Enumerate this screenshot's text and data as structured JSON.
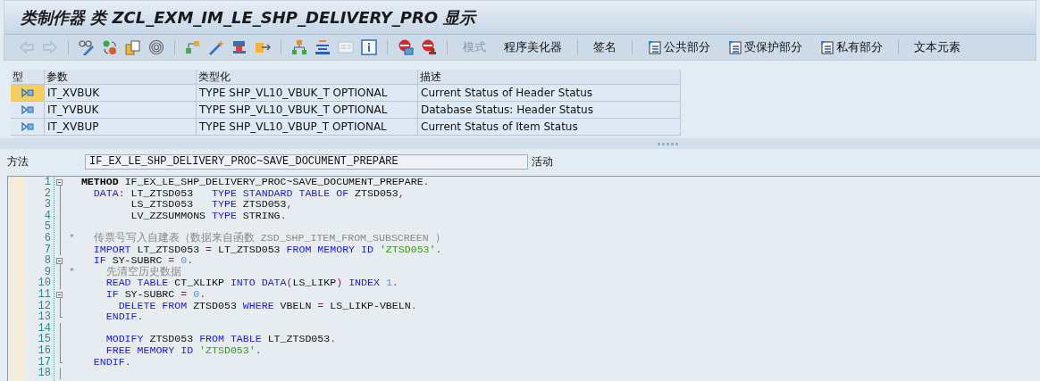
{
  "window": {
    "title": "类制作器 类 ZCL_EXM_IM_LE_SHP_DELIVERY_PRO 显示"
  },
  "toolbar": {
    "button_groups": [
      [
        {
          "label": "模式",
          "kind": "text",
          "disabled": true
        },
        {
          "label": "程序美化器",
          "kind": "text",
          "disabled": false
        }
      ],
      [
        {
          "label": "签名",
          "kind": "text",
          "disabled": false
        }
      ],
      [
        {
          "label": "公共部分",
          "kind": "section",
          "disabled": false
        },
        {
          "label": "受保护部分",
          "kind": "section",
          "disabled": false
        },
        {
          "label": "私有部分",
          "kind": "section",
          "disabled": false
        }
      ],
      [
        {
          "label": "文本元素",
          "kind": "text",
          "disabled": false
        }
      ]
    ]
  },
  "parameters": {
    "columns": [
      "型",
      "参数",
      "类型化",
      "描述"
    ],
    "rows": [
      {
        "name": "IT_XVBUK",
        "typing": "TYPE SHP_VL10_VBUK_T OPTIONAL",
        "description": "Current Status of Header Status",
        "selected": true
      },
      {
        "name": "IT_YVBUK",
        "typing": "TYPE SHP_VL10_VBUK_T OPTIONAL",
        "description": "Database Status: Header Status",
        "selected": false
      },
      {
        "name": "IT_XVBUP",
        "typing": "TYPE SHP_VL10_VBUP_T OPTIONAL",
        "description": "Current Status of Item Status",
        "selected": false
      }
    ]
  },
  "method": {
    "label": "方法",
    "value": "IF_EX_LE_SHP_DELIVERY_PROC~SAVE_DOCUMENT_PREPARE",
    "status": "活动"
  },
  "editor": {
    "lines": [
      {
        "number": "1",
        "kind": "fold-start",
        "tokens": [
          {
            "t": "  METHOD",
            "kind": "bold"
          },
          {
            "t": " IF_EX_LE_SHP_DELIVERY_PROC~SAVE_DOCUMENT_PREPARE",
            "kind": "id"
          },
          {
            "t": ".",
            "kind": "punct"
          }
        ]
      },
      {
        "number": "2",
        "kind": "plain",
        "tokens": [
          {
            "t": "    DATA",
            "kind": "kw"
          },
          {
            "t": ":",
            "kind": "punct"
          },
          {
            "t": " LT_ZTSD053   ",
            "kind": "id"
          },
          {
            "t": "TYPE STANDARD TABLE OF",
            "kind": "kw"
          },
          {
            "t": " ZTSD053",
            "kind": "id"
          },
          {
            "t": ",",
            "kind": "punct"
          }
        ]
      },
      {
        "number": "3",
        "kind": "plain",
        "tokens": [
          {
            "t": "          LS_ZTSD053   ",
            "kind": "id"
          },
          {
            "t": "TYPE",
            "kind": "kw"
          },
          {
            "t": " ZTSD053",
            "kind": "id"
          },
          {
            "t": ",",
            "kind": "punct"
          }
        ]
      },
      {
        "number": "4",
        "kind": "plain",
        "tokens": [
          {
            "t": "          LV_ZZSUMMONS ",
            "kind": "id"
          },
          {
            "t": "TYPE",
            "kind": "kw"
          },
          {
            "t": " STRING",
            "kind": "id"
          },
          {
            "t": ".",
            "kind": "punct"
          }
        ]
      },
      {
        "number": "5",
        "kind": "plain"
      },
      {
        "number": "6",
        "kind": "plain",
        "tokens": [
          {
            "t": "*   传票号写入自建表（数据来自函数 ZSD_SHP_ITEM_FROM_SUBSCREEN ）",
            "kind": "comment"
          }
        ]
      },
      {
        "number": "7",
        "kind": "plain",
        "tokens": [
          {
            "t": "    IMPORT",
            "kind": "kw"
          },
          {
            "t": " LT_ZTSD053 ",
            "kind": "id"
          },
          {
            "t": "=",
            "kind": "punct"
          },
          {
            "t": " LT_ZTSD053 ",
            "kind": "id"
          },
          {
            "t": "FROM MEMORY ID",
            "kind": "kw"
          },
          {
            "t": " 'ZTSD053'",
            "kind": "str"
          },
          {
            "t": ".",
            "kind": "punct"
          }
        ]
      },
      {
        "number": "8",
        "kind": "fold-start",
        "tokens": [
          {
            "t": "    IF",
            "kind": "kw"
          },
          {
            "t": " SY-SUBRC ",
            "kind": "id"
          },
          {
            "t": "=",
            "kind": "punct"
          },
          {
            "t": " 0",
            "kind": "num"
          },
          {
            "t": ".",
            "kind": "punct"
          }
        ]
      },
      {
        "number": "9",
        "kind": "plain",
        "tokens": [
          {
            "t": "*     先清空历史数据",
            "kind": "comment"
          }
        ]
      },
      {
        "number": "10",
        "kind": "plain",
        "tokens": [
          {
            "t": "      READ TABLE",
            "kind": "kw"
          },
          {
            "t": " CT_XLIKP ",
            "kind": "id"
          },
          {
            "t": "INTO DATA",
            "kind": "kw"
          },
          {
            "t": "(",
            "kind": "punct"
          },
          {
            "t": "LS_LIKP",
            "kind": "id"
          },
          {
            "t": ")",
            "kind": "punct"
          },
          {
            "t": " INDEX",
            "kind": "kw"
          },
          {
            "t": " 1",
            "kind": "num"
          },
          {
            "t": ".",
            "kind": "punct"
          }
        ]
      },
      {
        "number": "11",
        "kind": "fold-start",
        "tokens": [
          {
            "t": "      IF",
            "kind": "kw"
          },
          {
            "t": " SY-SUBRC ",
            "kind": "id"
          },
          {
            "t": "=",
            "kind": "punct"
          },
          {
            "t": " 0",
            "kind": "num"
          },
          {
            "t": ".",
            "kind": "punct"
          }
        ]
      },
      {
        "number": "12",
        "kind": "plain",
        "tokens": [
          {
            "t": "        DELETE FROM",
            "kind": "kw"
          },
          {
            "t": " ZTSD053 ",
            "kind": "id"
          },
          {
            "t": "WHERE",
            "kind": "kw"
          },
          {
            "t": " VBELN ",
            "kind": "id"
          },
          {
            "t": "=",
            "kind": "punct"
          },
          {
            "t": " LS_LIKP-VBELN",
            "kind": "id"
          },
          {
            "t": ".",
            "kind": "punct"
          }
        ]
      },
      {
        "number": "13",
        "kind": "fold-end",
        "tokens": [
          {
            "t": "      ENDIF",
            "kind": "kw"
          },
          {
            "t": ".",
            "kind": "punct"
          }
        ]
      },
      {
        "number": "14",
        "kind": "plain"
      },
      {
        "number": "15",
        "kind": "plain",
        "tokens": [
          {
            "t": "      MODIFY",
            "kind": "kw"
          },
          {
            "t": " ZTSD053 ",
            "kind": "id"
          },
          {
            "t": "FROM TABLE",
            "kind": "kw"
          },
          {
            "t": " LT_ZTSD053",
            "kind": "id"
          },
          {
            "t": ".",
            "kind": "punct"
          }
        ]
      },
      {
        "number": "16",
        "kind": "plain",
        "tokens": [
          {
            "t": "      FREE MEMORY ID",
            "kind": "kw"
          },
          {
            "t": " 'ZTSD053'",
            "kind": "str"
          },
          {
            "t": ".",
            "kind": "punct"
          }
        ]
      },
      {
        "number": "17",
        "kind": "fold-end",
        "tokens": [
          {
            "t": "    ENDIF",
            "kind": "kw"
          },
          {
            "t": ".",
            "kind": "punct"
          }
        ]
      },
      {
        "number": "18",
        "kind": "plain"
      }
    ]
  }
}
